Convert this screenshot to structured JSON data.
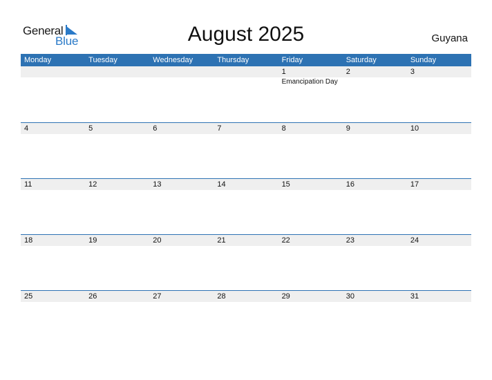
{
  "logo": {
    "line1": "General",
    "line2": "Blue"
  },
  "title": "August 2025",
  "country": "Guyana",
  "weekdays": [
    "Monday",
    "Tuesday",
    "Wednesday",
    "Thursday",
    "Friday",
    "Saturday",
    "Sunday"
  ],
  "weeks": [
    {
      "days": [
        "",
        "",
        "",
        "",
        "1",
        "2",
        "3"
      ],
      "events": [
        "",
        "",
        "",
        "",
        "Emancipation Day",
        "",
        ""
      ]
    },
    {
      "days": [
        "4",
        "5",
        "6",
        "7",
        "8",
        "9",
        "10"
      ],
      "events": [
        "",
        "",
        "",
        "",
        "",
        "",
        ""
      ]
    },
    {
      "days": [
        "11",
        "12",
        "13",
        "14",
        "15",
        "16",
        "17"
      ],
      "events": [
        "",
        "",
        "",
        "",
        "",
        "",
        ""
      ]
    },
    {
      "days": [
        "18",
        "19",
        "20",
        "21",
        "22",
        "23",
        "24"
      ],
      "events": [
        "",
        "",
        "",
        "",
        "",
        "",
        ""
      ]
    },
    {
      "days": [
        "25",
        "26",
        "27",
        "28",
        "29",
        "30",
        "31"
      ],
      "events": [
        "",
        "",
        "",
        "",
        "",
        "",
        ""
      ]
    }
  ],
  "colors": {
    "header": "#2d72b3",
    "brand_blue": "#2a7ac8",
    "date_strip": "#efefef"
  }
}
